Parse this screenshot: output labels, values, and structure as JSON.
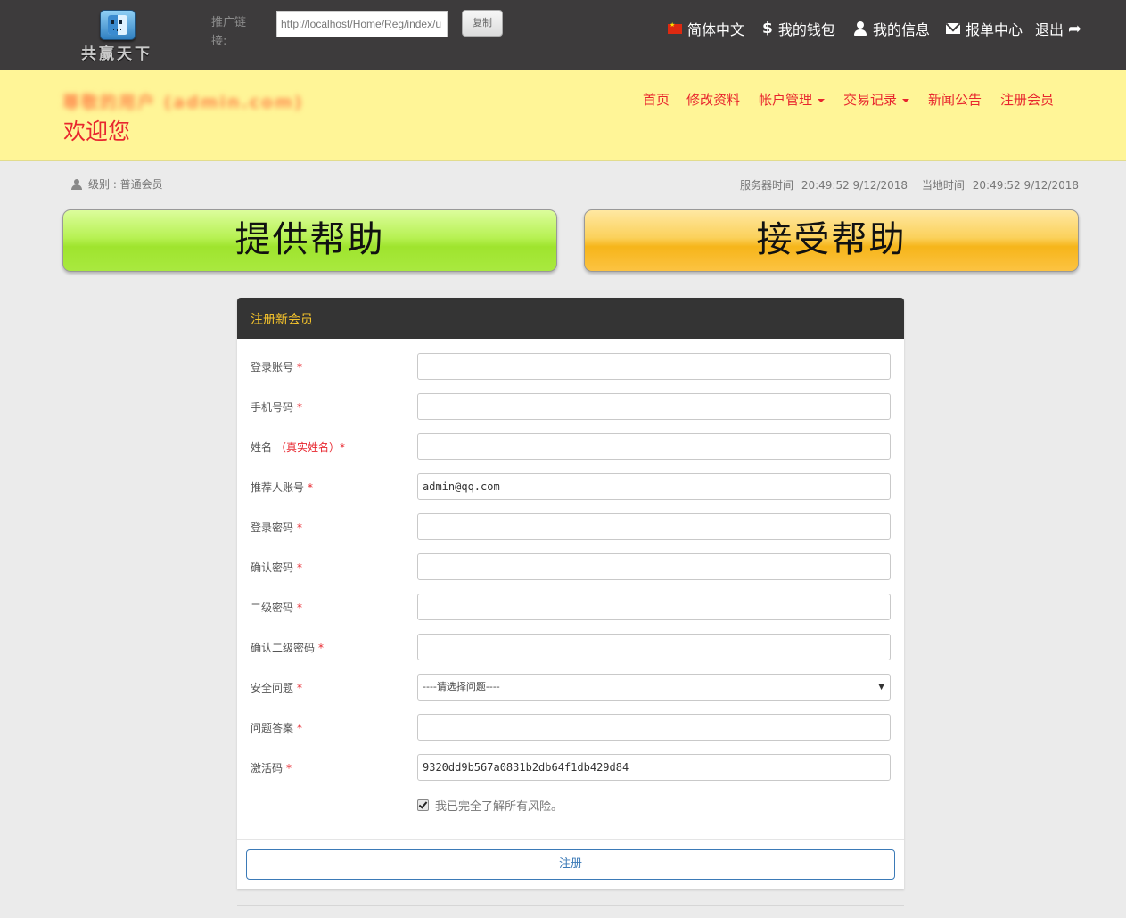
{
  "brand": {
    "name": "共赢天下",
    "icon": "finder-face-icon"
  },
  "promo": {
    "label": "推广链接:",
    "link": "http://localhost/Home/Reg/index/u",
    "copy_label": "复制"
  },
  "topnav": [
    {
      "icon": "china-flag-icon",
      "label": "简体中文"
    },
    {
      "icon": "dollar-icon",
      "label": "我的钱包"
    },
    {
      "icon": "user-icon",
      "label": "我的信息"
    },
    {
      "icon": "envelope-icon",
      "label": "报单中心"
    },
    {
      "icon": "share-arrow-icon",
      "label": "退出"
    }
  ],
  "header": {
    "user_line": "尊敬的用户 (admin.com)",
    "welcome": "欢迎您"
  },
  "mainnav": [
    {
      "label": "首页",
      "dropdown": false
    },
    {
      "label": "修改资料",
      "dropdown": false
    },
    {
      "label": "帐户管理",
      "dropdown": true
    },
    {
      "label": "交易记录",
      "dropdown": true
    },
    {
      "label": "新闻公告",
      "dropdown": false
    },
    {
      "label": "注册会员",
      "dropdown": false
    }
  ],
  "info": {
    "level": "级别 : 普通会员",
    "server_time_label": "服务器时间",
    "server_time": "20:49:52 9/12/2018",
    "local_time_label": "当地时间",
    "local_time": "20:49:52 9/12/2018"
  },
  "big_buttons": {
    "provide": "提供帮助",
    "accept": "接受帮助"
  },
  "colors": {
    "topbar": "#3d3b3c",
    "header": "#fff597",
    "accent_red": "#e8262e",
    "panel_title": "#f5c32b",
    "green": "#a6e83a",
    "orange": "#f8be2a"
  },
  "form": {
    "title": "注册新会员",
    "fields": [
      {
        "label": "登录账号",
        "note": "",
        "req": "*",
        "value": ""
      },
      {
        "label": "手机号码",
        "note": "",
        "req": "*",
        "value": ""
      },
      {
        "label": "姓名",
        "note": "（真实姓名）",
        "req": "*",
        "value": ""
      },
      {
        "label": "推荐人账号",
        "note": "",
        "req": "*",
        "value": "admin@qq.com"
      },
      {
        "label": "登录密码",
        "note": "",
        "req": "*",
        "value": ""
      },
      {
        "label": "确认密码",
        "note": "",
        "req": "*",
        "value": ""
      },
      {
        "label": "二级密码",
        "note": "",
        "req": "*",
        "value": ""
      },
      {
        "label": "确认二级密码",
        "note": "",
        "req": "*",
        "value": ""
      },
      {
        "label": "安全问题",
        "note": "",
        "req": "*",
        "value": "----请选择问题----"
      },
      {
        "label": "问题答案",
        "note": "",
        "req": "*",
        "value": ""
      },
      {
        "label": "激活码",
        "note": "",
        "req": "*",
        "value": "9320dd9b567a0831b2db64f1db429d84"
      }
    ],
    "agree_text": "我已完全了解所有风险。",
    "agree_checked": true,
    "submit_label": "注册"
  }
}
